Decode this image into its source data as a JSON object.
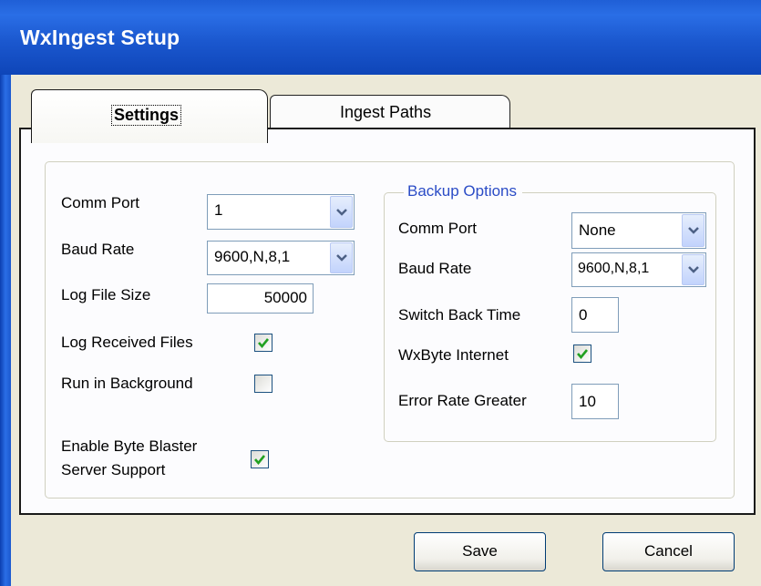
{
  "window": {
    "title": "WxIngest Setup"
  },
  "tabs": [
    {
      "label": "Settings",
      "selected": true
    },
    {
      "label": "Ingest Paths",
      "selected": false
    }
  ],
  "settings": {
    "comm_port": {
      "label": "Comm Port",
      "value": "1"
    },
    "baud_rate": {
      "label": "Baud Rate",
      "value": "9600,N,8,1"
    },
    "log_file_size": {
      "label": "Log File Size",
      "value": "50000"
    },
    "log_received_files": {
      "label": "Log Received Files",
      "checked": true
    },
    "run_in_background": {
      "label": "Run in Background",
      "checked": false
    },
    "byte_blaster": {
      "label_line1": "Enable Byte Blaster",
      "label_line2": "Server Support",
      "checked": true
    }
  },
  "backup": {
    "title": "Backup Options",
    "comm_port": {
      "label": "Comm Port",
      "value": "None"
    },
    "baud_rate": {
      "label": "Baud Rate",
      "value": "9600,N,8,1"
    },
    "switch_back_time": {
      "label": "Switch Back Time",
      "value": "0"
    },
    "wxbyte_internet": {
      "label": "WxByte Internet",
      "checked": true
    },
    "error_rate": {
      "label": "Error Rate Greater",
      "value": "10"
    }
  },
  "buttons": {
    "save": "Save",
    "cancel": "Cancel"
  },
  "colors": {
    "title_bar": "#1f5fd6",
    "group_title": "#2b4cc6",
    "check_mark": "#21a121",
    "dialog_face": "#ece9d8"
  },
  "icons": {
    "dropdown": "chevron-down-icon",
    "check": "check-icon"
  }
}
